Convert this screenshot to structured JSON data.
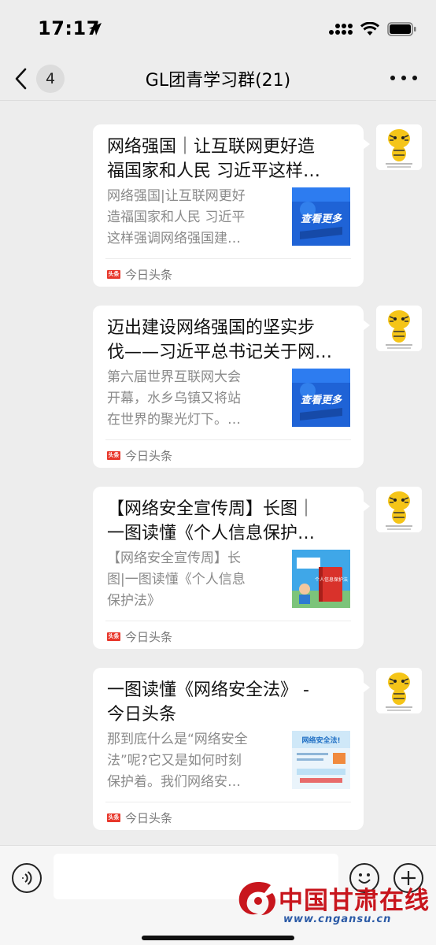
{
  "status_bar": {
    "time": "17:17"
  },
  "nav": {
    "unread_count": "4",
    "title": "GL团青学习群(21)"
  },
  "messages": [
    {
      "title_lines": [
        "网络强国｜让互联网更好造",
        "福国家和人民 习近平这样…"
      ],
      "desc_lines": [
        "网络强国|让互联网更好",
        "造福国家和人民 习近平",
        "这样强调网络强国建…"
      ],
      "thumb_text": "查看更多",
      "source": "今日头条",
      "source_logo": "头条"
    },
    {
      "title_lines": [
        "迈出建设网络强国的坚实步",
        "伐——习近平总书记关于网…"
      ],
      "desc_lines": [
        "第六届世界互联网大会",
        "开幕，水乡乌镇又将站",
        "在世界的聚光灯下。…"
      ],
      "thumb_text": "查看更多",
      "source": "今日头条",
      "source_logo": "头条"
    },
    {
      "title_lines": [
        "【网络安全宣传周】长图｜",
        "一图读懂《个人信息保护…"
      ],
      "desc_lines": [
        "【网络安全宣传周】长",
        "图|一图读懂《个人信息",
        "保护法》"
      ],
      "thumb_text": "个人信息保护法",
      "source": "今日头条",
      "source_logo": "头条"
    },
    {
      "title_lines": [
        "一图读懂《网络安全法》 -",
        "今日头条"
      ],
      "desc_lines": [
        "那到底什么是“网络安全",
        "法”呢?它又是如何时刻",
        "保护着。我们网络安…"
      ],
      "thumb_text": "网络安全法!",
      "source": "今日头条",
      "source_logo": "头条"
    }
  ],
  "watermark": {
    "text": "中国甘肃在线",
    "url": "www.cngansu.cn"
  },
  "colors": {
    "background": "#ededed",
    "bubble": "#ffffff",
    "source_red": "#e8372b",
    "watermark_red": "#c8161d"
  },
  "icons": [
    "location-arrow-icon",
    "signal-icon",
    "wifi-icon",
    "battery-icon",
    "back-chevron-icon",
    "more-icon",
    "voice-icon",
    "emoji-icon",
    "plus-icon"
  ]
}
